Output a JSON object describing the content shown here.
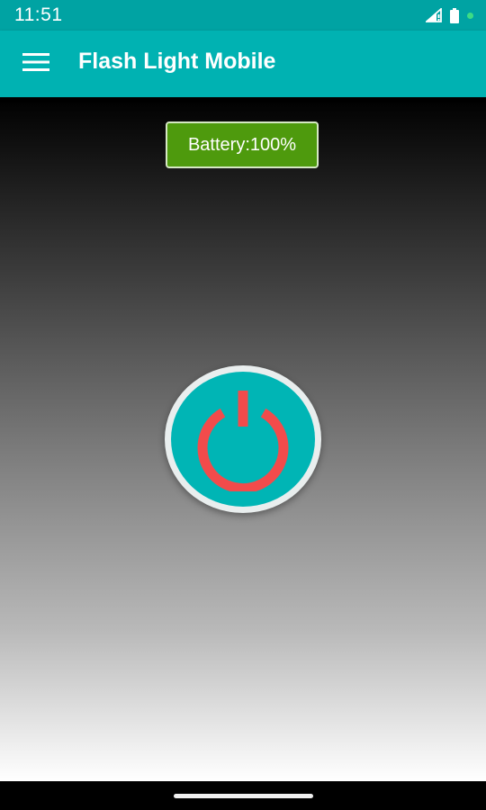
{
  "status_bar": {
    "time": "11:51",
    "icons": [
      "signal-icon",
      "battery-icon",
      "notification-dot-icon"
    ],
    "dot_color": "#3DDC84"
  },
  "app_bar": {
    "title": "Flash Light Mobile",
    "menu_icon": "hamburger-menu-icon"
  },
  "main": {
    "battery_label": "Battery:100%",
    "power_icon": "power-icon",
    "power_color": "#F24B4B"
  },
  "colors": {
    "status_bar": "#00A3A3",
    "app_bar": "#00B2B2",
    "battery_badge": "#4E9A0D",
    "power_button_face": "#00B5B5"
  },
  "nav_bar": {
    "home_handle": "home-gesture-handle"
  }
}
